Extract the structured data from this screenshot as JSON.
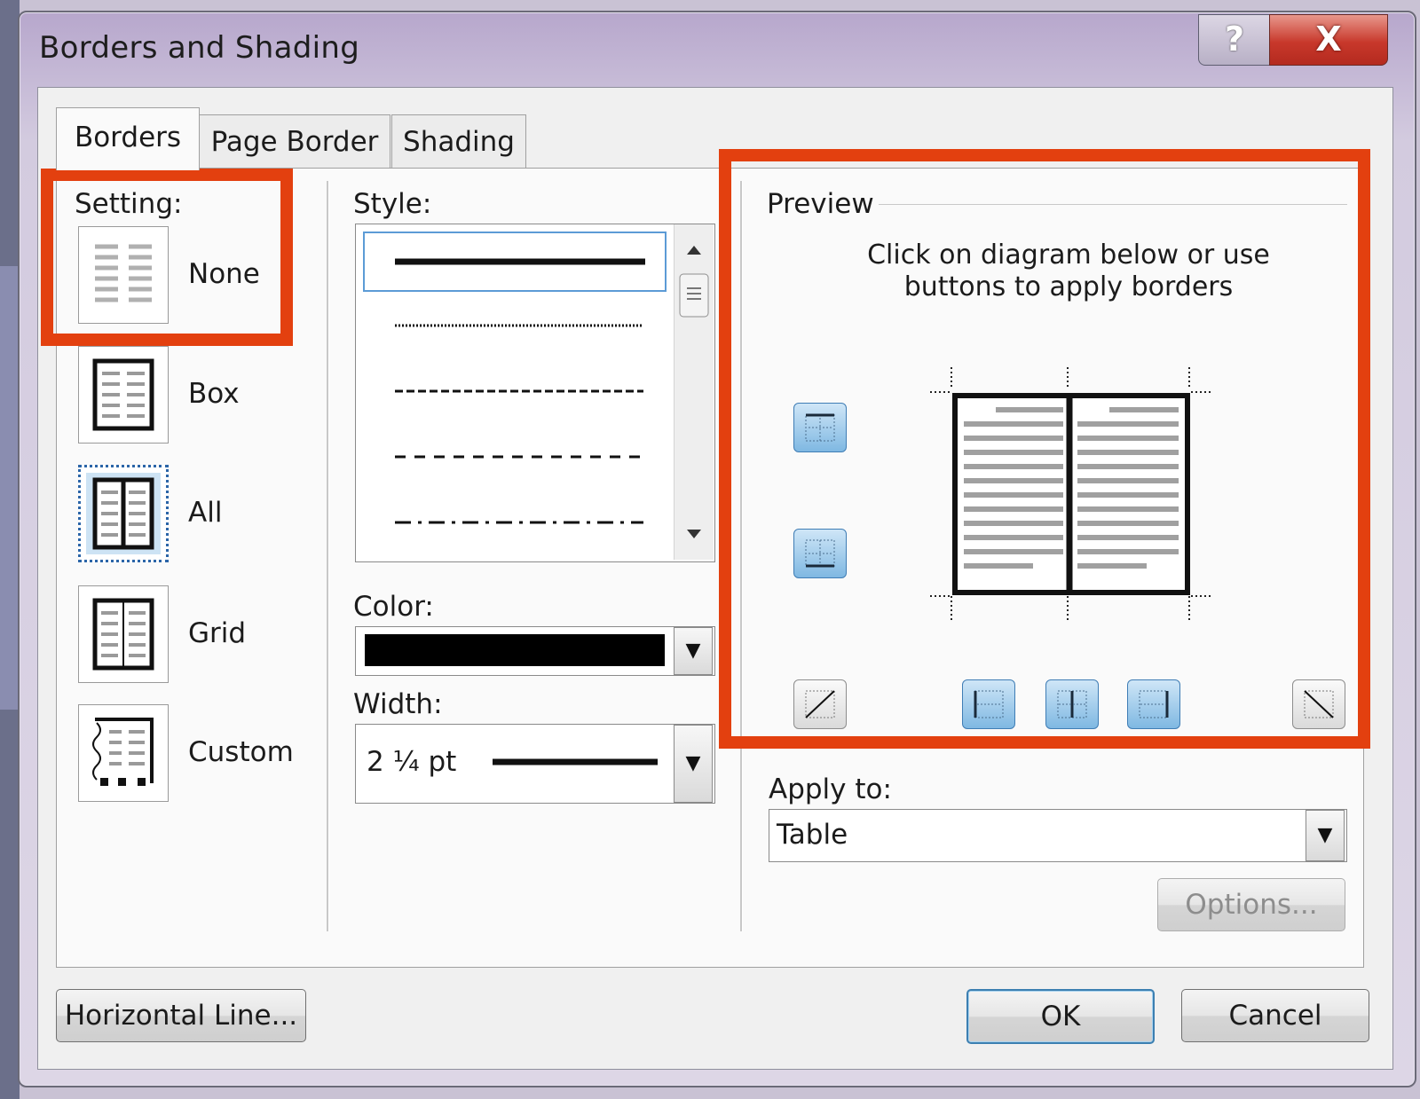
{
  "window": {
    "title": "Borders and Shading",
    "help": "?",
    "close": "X"
  },
  "tabs": [
    {
      "label": "Borders",
      "active": true
    },
    {
      "label": "Page Border",
      "active": false
    },
    {
      "label": "Shading",
      "active": false
    }
  ],
  "setting": {
    "label": "Setting:",
    "options": [
      {
        "label": "None",
        "selected": false
      },
      {
        "label": "Box",
        "selected": false
      },
      {
        "label": "All",
        "selected": true
      },
      {
        "label": "Grid",
        "selected": false
      },
      {
        "label": "Custom",
        "selected": false
      }
    ]
  },
  "style": {
    "label": "Style:"
  },
  "color": {
    "label": "Color:",
    "value": "#000000"
  },
  "width": {
    "label": "Width:",
    "value": "2 ¼ pt"
  },
  "preview": {
    "label": "Preview",
    "instruction_line1": "Click on diagram below or use",
    "instruction_line2": "buttons to apply borders"
  },
  "apply_to": {
    "label": "Apply to:",
    "value": "Table"
  },
  "buttons": {
    "options": "Options...",
    "horizontal_line": "Horizontal Line...",
    "ok": "OK",
    "cancel": "Cancel"
  },
  "colors": {
    "highlight": "#e3400f",
    "accent": "#3f7db5"
  }
}
